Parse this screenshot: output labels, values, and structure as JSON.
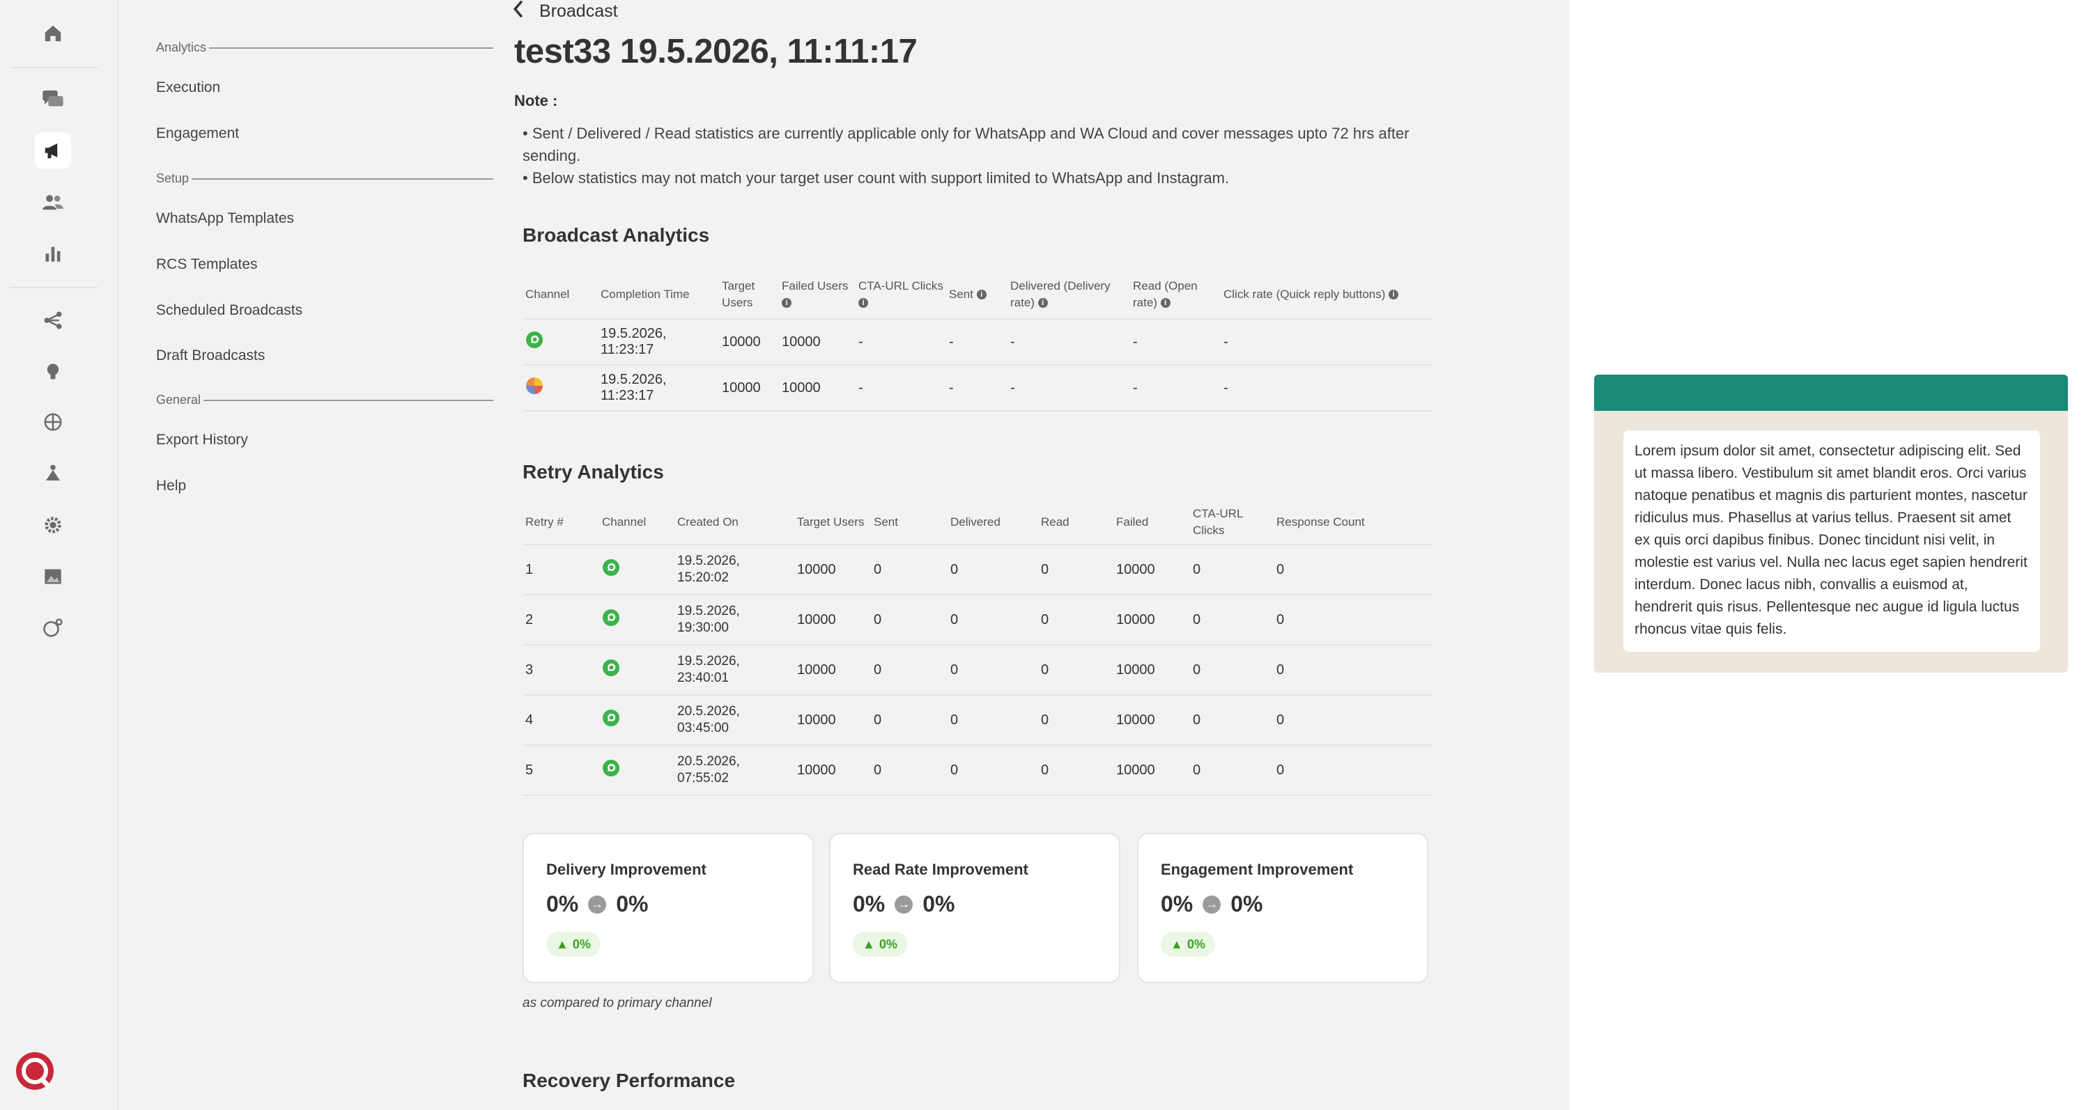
{
  "rail": {
    "icons": [
      "home-icon",
      "chat-icon",
      "megaphone-icon",
      "users-icon",
      "bar-chart-icon",
      "flow-icon",
      "bulb-icon",
      "globe-icon",
      "hierarchy-icon",
      "gear-icon",
      "image-icon",
      "whatsapp-settings-icon"
    ],
    "active": "megaphone-icon"
  },
  "subnav": {
    "analytics_header": "Analytics",
    "analytics_items": [
      "Execution",
      "Engagement"
    ],
    "setup_header": "Setup",
    "setup_items": [
      "WhatsApp Templates",
      "RCS Templates",
      "Scheduled Broadcasts",
      "Draft Broadcasts"
    ],
    "general_header": "General",
    "general_items": [
      "Export History",
      "Help"
    ]
  },
  "breadcrumb": {
    "back_label": "Broadcast"
  },
  "page": {
    "title": "test33 19.5.2026, 11:11:17",
    "note_label": "Note :",
    "notes": [
      "Sent / Delivered / Read statistics are currently applicable only for WhatsApp and WA Cloud and cover messages upto 72 hrs after sending.",
      "Below statistics may not match your target user count with support limited to WhatsApp and Instagram."
    ]
  },
  "broadcast_analytics": {
    "title": "Broadcast Analytics",
    "columns": [
      "Channel",
      "Completion Time",
      "Target Users",
      "Failed Users",
      "CTA-URL Clicks",
      "Sent",
      "Delivered (Delivery rate)",
      "Read (Open rate)",
      "Click rate (Quick reply buttons)"
    ],
    "rows": [
      {
        "channel_icon": "whatsapp-icon",
        "completion": "19.5.2026, 11:23:17",
        "target": "10000",
        "failed": "10000",
        "cta": "-",
        "sent": "-",
        "delivered": "-",
        "read": "-",
        "click": "-"
      },
      {
        "channel_icon": "rcs-icon",
        "completion": "19.5.2026, 11:23:17",
        "target": "10000",
        "failed": "10000",
        "cta": "-",
        "sent": "-",
        "delivered": "-",
        "read": "-",
        "click": "-"
      }
    ]
  },
  "retry_analytics": {
    "title": "Retry Analytics",
    "columns": [
      "Retry #",
      "Channel",
      "Created On",
      "Target Users",
      "Sent",
      "Delivered",
      "Read",
      "Failed",
      "CTA-URL Clicks",
      "Response Count"
    ],
    "rows": [
      {
        "retry": "1",
        "date": "19.5.2026,",
        "time": "15:20:02",
        "target": "10000",
        "sent": "0",
        "delivered": "0",
        "read": "0",
        "failed": "10000",
        "cta": "0",
        "response": "0"
      },
      {
        "retry": "2",
        "date": "19.5.2026,",
        "time": "19:30:00",
        "target": "10000",
        "sent": "0",
        "delivered": "0",
        "read": "0",
        "failed": "10000",
        "cta": "0",
        "response": "0"
      },
      {
        "retry": "3",
        "date": "19.5.2026,",
        "time": "23:40:01",
        "target": "10000",
        "sent": "0",
        "delivered": "0",
        "read": "0",
        "failed": "10000",
        "cta": "0",
        "response": "0"
      },
      {
        "retry": "4",
        "date": "20.5.2026,",
        "time": "03:45:00",
        "target": "10000",
        "sent": "0",
        "delivered": "0",
        "read": "0",
        "failed": "10000",
        "cta": "0",
        "response": "0"
      },
      {
        "retry": "5",
        "date": "20.5.2026,",
        "time": "07:55:02",
        "target": "10000",
        "sent": "0",
        "delivered": "0",
        "read": "0",
        "failed": "10000",
        "cta": "0",
        "response": "0"
      }
    ]
  },
  "improvements": [
    {
      "title": "Delivery Improvement",
      "from": "0%",
      "to": "0%",
      "delta": "0%"
    },
    {
      "title": "Read Rate Improvement",
      "from": "0%",
      "to": "0%",
      "delta": "0%"
    },
    {
      "title": "Engagement Improvement",
      "from": "0%",
      "to": "0%",
      "delta": "0%"
    }
  ],
  "footnote": "as compared to primary channel",
  "recovery_title": "Recovery Performance",
  "preview": {
    "message": "Lorem ipsum dolor sit amet, consectetur adipiscing elit. Sed ut massa libero. Vestibulum sit amet blandit eros. Orci varius natoque penatibus et magnis dis parturient montes, nascetur ridiculus mus. Phasellus at varius tellus. Praesent sit amet ex quis orci dapibus finibus. Donec tincidunt nisi velit, in molestie est varius vel. Nulla nec lacus eget sapien hendrerit interdum. Donec lacus nibh, convallis a euismod at, hendrerit quis risus. Pellentesque nec augue id ligula luctus rhoncus vitae quis felis.",
    "header_color": "#188a77"
  },
  "colors": {
    "accent_green": "#3aa020",
    "whatsapp": "#3cb34a",
    "brand": "#c7283a"
  }
}
